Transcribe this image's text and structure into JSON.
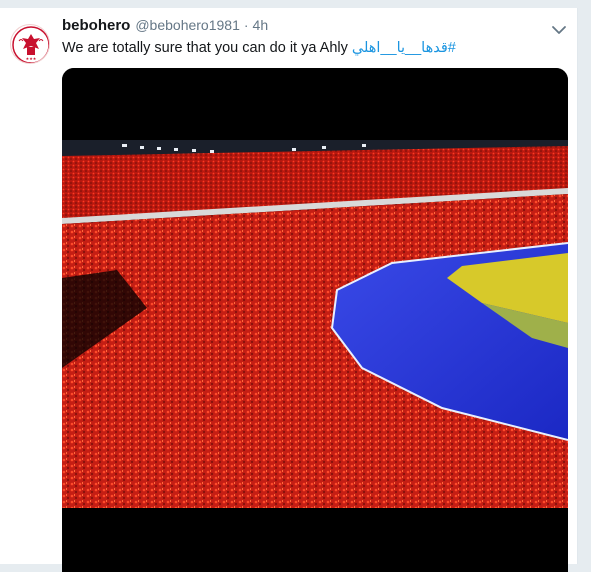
{
  "tweet": {
    "display_name": "bebohero",
    "handle": "@bebohero1981",
    "separator": "·",
    "time": "4h",
    "text": "We are totally sure that you can do it ya Ahly",
    "hashtag": "#قدها__يا__اهلي"
  },
  "icons": {
    "avatar": "al-ahly-logo",
    "menu": "chevron-down-icon"
  },
  "colors": {
    "accent": "#1b95e0",
    "crowd_red": "#d8261a",
    "track_blue": "#2636d9"
  }
}
